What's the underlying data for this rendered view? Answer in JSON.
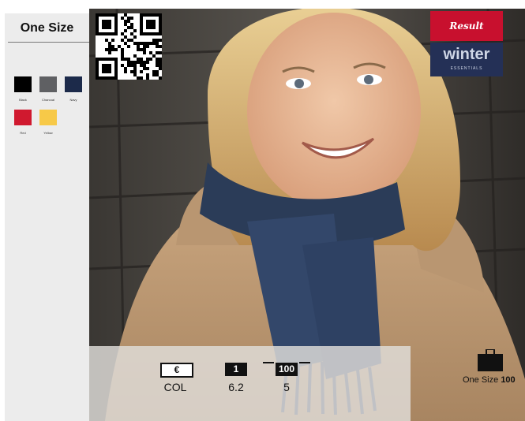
{
  "sidebar": {
    "size_title": "One Size",
    "colours": [
      {
        "name": "Black",
        "hex": "#000000"
      },
      {
        "name": "Charcoal",
        "hex": "#5f6063"
      },
      {
        "name": "Navy",
        "hex": "#1c2a4a"
      },
      {
        "name": "Red",
        "hex": "#d0192f"
      },
      {
        "name": "Yellow",
        "hex": "#f7c948"
      }
    ]
  },
  "brand": {
    "result": "Result",
    "winter": "winter",
    "essentials": "ESSENTIALS"
  },
  "info": {
    "currency_symbol": "€",
    "pack_qty": "1",
    "carton_qty": "100",
    "col_label": "COL",
    "weight": "6.2",
    "carton_value": "5"
  },
  "sizes": {
    "label": "One Size",
    "count": "100"
  }
}
